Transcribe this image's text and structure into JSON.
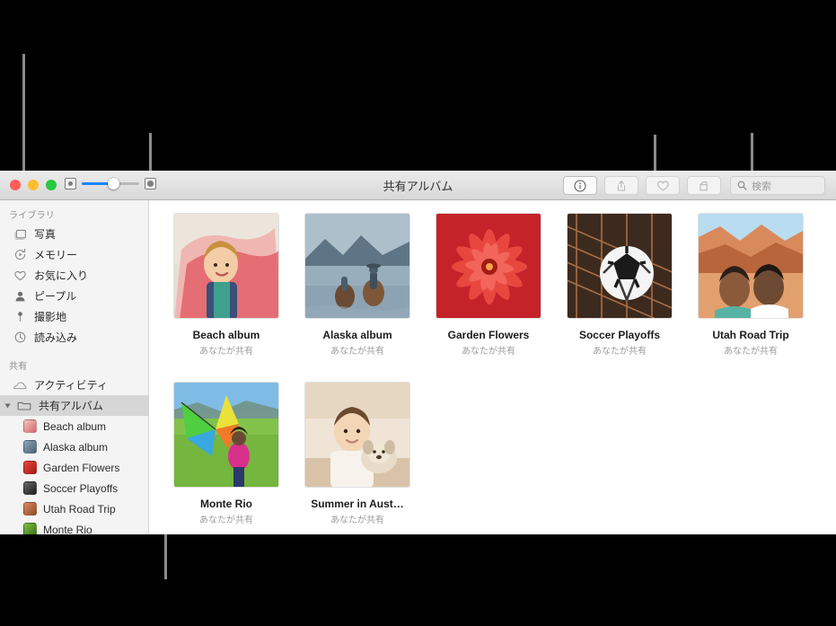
{
  "window": {
    "title": "共有アルバム",
    "traffic_lights": [
      {
        "name": "close",
        "color": "#ff5f57"
      },
      {
        "name": "minimize",
        "color": "#ffbd2e"
      },
      {
        "name": "zoom",
        "color": "#28c840"
      }
    ],
    "zoom_slider": {
      "value_percent": 55,
      "fill_color": "#1a86ff",
      "small_icon": "small-thumbnail-icon",
      "large_icon": "large-thumbnail-icon"
    },
    "toolbar_buttons": [
      {
        "name": "info-button",
        "icon": "info-circle-icon",
        "active": true
      },
      {
        "name": "share-button",
        "icon": "share-arrow-icon",
        "active": false
      },
      {
        "name": "favorite-button",
        "icon": "heart-icon",
        "active": false
      },
      {
        "name": "rotate-button",
        "icon": "rotate-icon",
        "active": false
      }
    ],
    "search": {
      "placeholder": "検索",
      "value": "",
      "icon": "search-icon"
    }
  },
  "sidebar": {
    "sections": [
      {
        "header": "ライブラリ",
        "items": [
          {
            "label": "写真",
            "icon": "photos-icon"
          },
          {
            "label": "メモリー",
            "icon": "memories-icon"
          },
          {
            "label": "お気に入り",
            "icon": "heart-icon"
          },
          {
            "label": "ピープル",
            "icon": "people-icon"
          },
          {
            "label": "撮影地",
            "icon": "places-pin-icon"
          },
          {
            "label": "読み込み",
            "icon": "import-clock-icon"
          }
        ]
      },
      {
        "header": "共有",
        "items": [
          {
            "label": "アクティビティ",
            "icon": "cloud-icon"
          },
          {
            "label": "共有アルバム",
            "icon": "folder-icon",
            "selected": true,
            "expanded": true
          }
        ]
      }
    ],
    "shared_albums": [
      {
        "label": "Beach album",
        "c1": "#f2c8c0",
        "c2": "#d4646a"
      },
      {
        "label": "Alaska album",
        "c1": "#8fa7b8",
        "c2": "#4b6274"
      },
      {
        "label": "Garden Flowers",
        "c1": "#e8473f",
        "c2": "#a21b16"
      },
      {
        "label": "Soccer Playoffs",
        "c1": "#6b6b6b",
        "c2": "#1d1d1d"
      },
      {
        "label": "Utah Road Trip",
        "c1": "#e08a60",
        "c2": "#8c4a2e"
      },
      {
        "label": "Monte Rio",
        "c1": "#7fc241",
        "c2": "#3a6d1e"
      }
    ]
  },
  "content": {
    "shared_by_label": "あなたが共有",
    "albums": [
      {
        "name": "Beach album",
        "subtitle": "あなたが共有",
        "sky": "#e6dfd6",
        "mid": "#f0b7b2",
        "accent": "#e2565f"
      },
      {
        "name": "Alaska album",
        "subtitle": "あなたが共有",
        "sky": "#aebfcc",
        "mid": "#7d93a4",
        "accent": "#4a5d6b"
      },
      {
        "name": "Garden Flowers",
        "subtitle": "あなたが共有",
        "sky": "#f04a3c",
        "mid": "#cf2a20",
        "accent": "#8e1410"
      },
      {
        "name": "Soccer Playoffs",
        "subtitle": "あなたが共有",
        "sky": "#cfcfcf",
        "mid": "#6d6d6d",
        "accent": "#141414"
      },
      {
        "name": "Utah Road Trip",
        "subtitle": "あなたが共有",
        "sky": "#cfe3f2",
        "mid": "#d98a5c",
        "accent": "#8e462a"
      },
      {
        "name": "Monte Rio",
        "subtitle": "あなたが共有",
        "sky": "#8ec4e8",
        "mid": "#74b63e",
        "accent": "#d8308a"
      },
      {
        "name": "Summer in Aust…",
        "subtitle": "あなたが共有",
        "sky": "#efe4d6",
        "mid": "#d8c3a8",
        "accent": "#8a6a4c"
      }
    ]
  },
  "callouts": {
    "line_color": "#8c8c8c",
    "lines": [
      {
        "name": "callout-to-library-header"
      },
      {
        "name": "callout-to-shared-albums"
      },
      {
        "name": "callout-to-album-list"
      },
      {
        "name": "callout-to-grid-item"
      },
      {
        "name": "callout-to-grid-item-right"
      }
    ]
  }
}
